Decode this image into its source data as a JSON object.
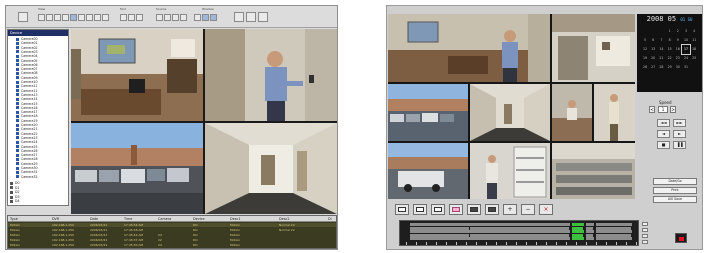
{
  "left_window": {
    "toolbar": {
      "groups": [
        "View",
        "Tool",
        "Source",
        "Window"
      ]
    },
    "tree": {
      "root_label": "Device",
      "cameras": [
        "Camera00",
        "Camera01",
        "Camera02",
        "Camera03",
        "Camera04",
        "Camera05",
        "Camera06",
        "Camera07",
        "Camera08",
        "Camera09",
        "Camera10",
        "Camera11",
        "Camera12",
        "Camera13",
        "Camera14",
        "Camera15",
        "Camera16",
        "Camera17",
        "Camera18",
        "Camera19",
        "Camera20",
        "Camera21",
        "Camera22",
        "Camera23",
        "Camera24",
        "Camera25",
        "Camera26",
        "Camera27",
        "Camera28",
        "Camera29",
        "Camera30",
        "Camera31",
        "Camera32"
      ],
      "extra_nodes": [
        "D0",
        "D1",
        "D2",
        "D3",
        "D4"
      ]
    },
    "log": {
      "columns": [
        "Type",
        "DVR",
        "Date",
        "Time",
        "Camera",
        "Device",
        "Desc1",
        "Desc2",
        "Di"
      ],
      "rows": [
        [
          "Motion",
          "192.168.1.250",
          "2006/03/21",
          "17:45:54 AM",
          "",
          "DO",
          "Motion",
          "Normal 24"
        ],
        [
          "Motion",
          "192.168.1.250",
          "2006/03/21",
          "17:45:48 AM",
          "",
          "DO",
          "Motion",
          "Normal 22"
        ],
        [
          "Motion",
          "192.168.1.250",
          "2006/03/21",
          "17:45:42 AM",
          "24",
          "DO",
          "Motion",
          ""
        ],
        [
          "Motion",
          "192.168.1.250",
          "2006/03/21",
          "17:45:37 AM",
          "22",
          "DO",
          "Motion",
          ""
        ],
        [
          "Motion",
          "192.168.1.250",
          "2006/03/21",
          "17:45:30 AM",
          "24",
          "DO",
          "Motion",
          ""
        ]
      ]
    }
  },
  "right_window": {
    "clock": {
      "time": "2008 05",
      "day_label": "01 SU"
    },
    "calendar": {
      "days": [
        "1",
        "2",
        "3",
        "4",
        "5",
        "6",
        "7",
        "8",
        "9",
        "10",
        "11",
        "12",
        "13",
        "14",
        "15",
        "16",
        "17",
        "18",
        "19",
        "20",
        "21",
        "22",
        "23",
        "24",
        "25",
        "26",
        "27",
        "28",
        "29",
        "30",
        "31"
      ],
      "highlighted": "17"
    },
    "speed": {
      "label": "Speed",
      "value": "1",
      "dec": "<",
      "inc": ">"
    },
    "ptz_buttons": [
      "◄◄",
      "►►",
      "◄",
      "►",
      "■",
      "▐▐"
    ],
    "actions": [
      "Date/Go",
      "Print",
      "AVI Save"
    ],
    "layout_buttons": [
      "1",
      "4",
      "6",
      "9",
      "13",
      "16",
      "+",
      "−",
      "×"
    ],
    "colors": {
      "accent_blue": "#56c6ff",
      "record_red": "#e0141a",
      "timeline_green": "#3fbf3f",
      "timeline_gray": "#8c8c8c"
    }
  }
}
